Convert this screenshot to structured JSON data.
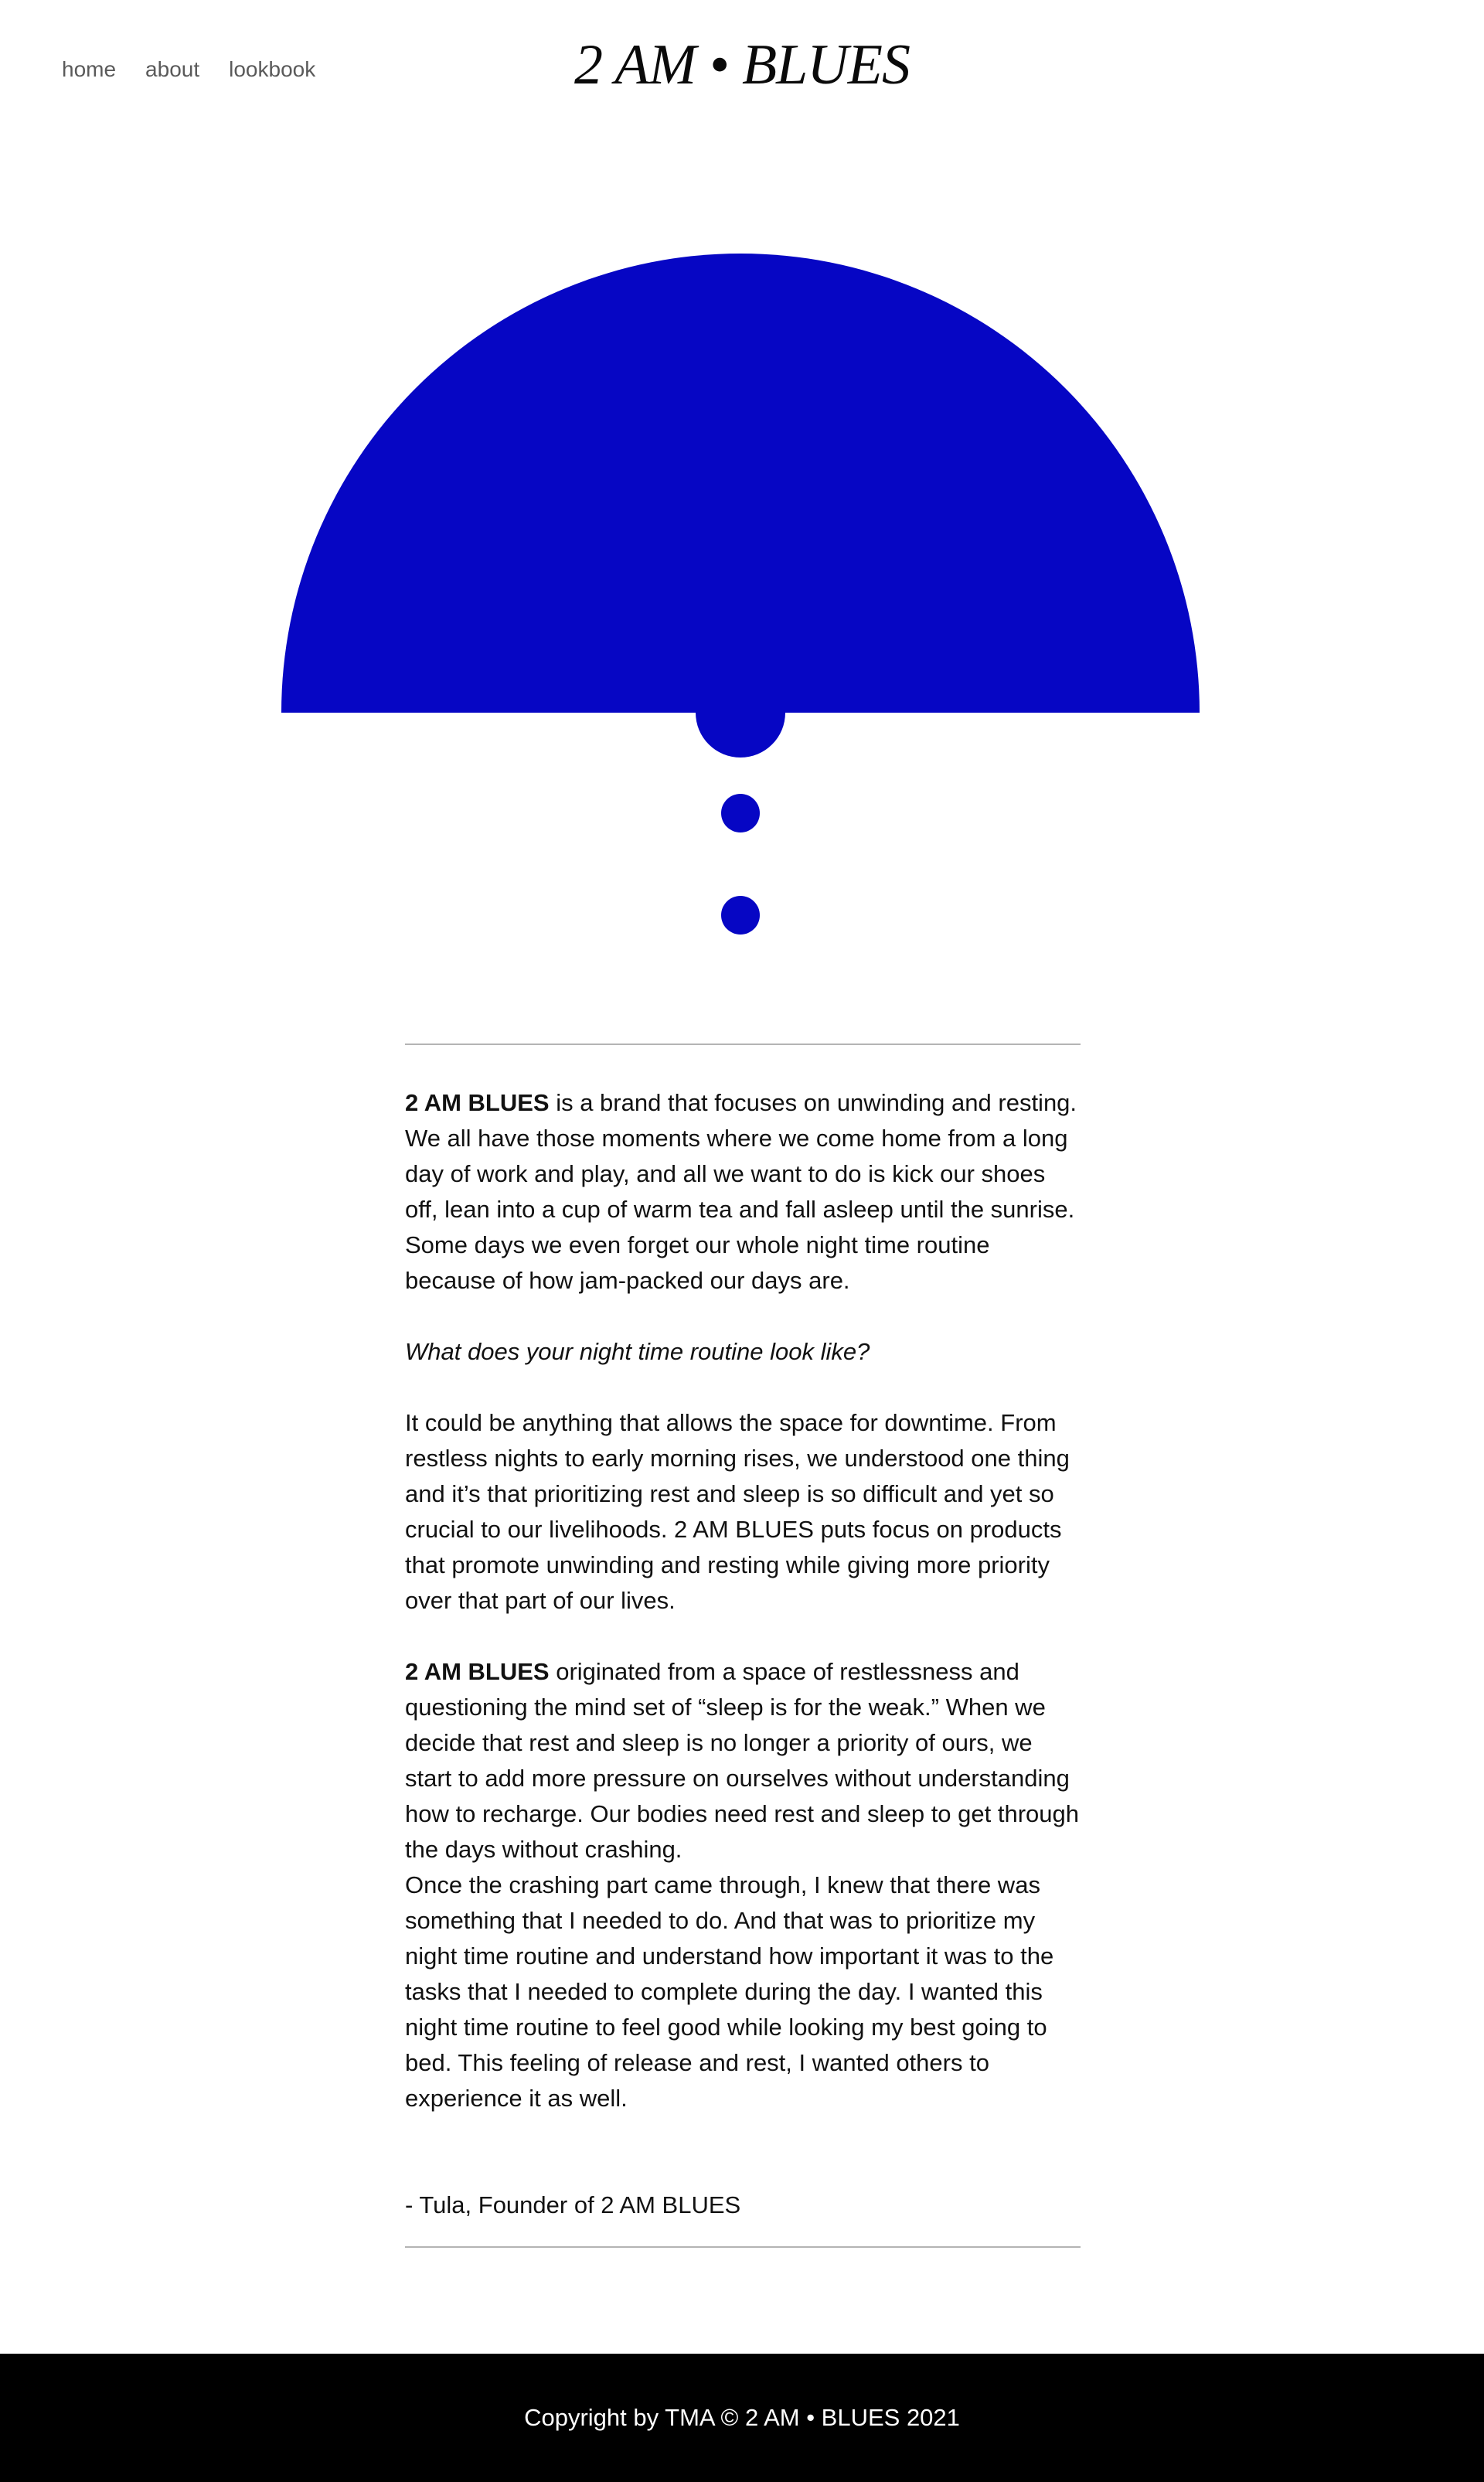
{
  "header": {
    "nav": [
      {
        "label": "home"
      },
      {
        "label": "about"
      },
      {
        "label": "lookbook"
      }
    ],
    "logo": "2 AM • BLUES"
  },
  "hero": {
    "icon": "moon-rising-icon",
    "color": "#0606c4"
  },
  "about": {
    "p1_brand": "2 AM BLUES",
    "p1_text": " is a brand that focuses on unwinding and resting. We all have those moments where we come home from a long day of work and play, and all we want to do is kick our shoes off, lean into a cup of warm tea and fall asleep until the sunrise. Some days we even forget our whole night time routine because of how jam-packed our days are.",
    "question": "What does your night time routine look like?",
    "p2_text": "It could be anything that allows the space for downtime. From restless nights to early morning rises, we understood one thing and it’s that prioritizing rest and sleep is so difficult and yet so crucial to our livelihoods. 2 AM BLUES puts focus on products that promote unwinding and resting while giving more priority over that part of our lives.",
    "p3_brand": "2 AM BLUES",
    "p3_text": " originated from a space of restlessness and questioning the mind set of “sleep is for the weak.” When we decide that rest and sleep is no longer a priority of ours, we start to add more pressure on ourselves without understanding how to recharge. Our bodies need rest and sleep to get through the days without crashing.",
    "p4_text": "Once the crashing part came through, I knew that there was something that I needed to do. And that was to prioritize my night time routine and understand how important it was to the tasks that I needed to complete during the day. I wanted this night time routine to feel good while looking my best going to bed. This feeling of release and rest, I wanted others to experience it as well.",
    "signature": "- Tula, Founder of 2 AM BLUES"
  },
  "footer": {
    "copyright": "Copyright by TMA © 2 AM • BLUES 2021"
  }
}
